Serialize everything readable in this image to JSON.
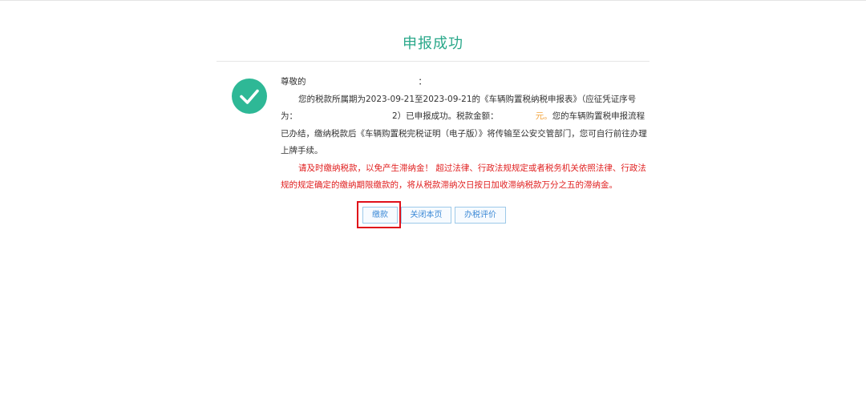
{
  "header": {
    "title": "申报成功"
  },
  "message": {
    "salutation_prefix": "尊敬的",
    "salutation_suffix": "：",
    "line1": "您的税款所属期为2023-09-21至2023-09-21的《车辆购置税纳税申报表》（应征凭证序号为：",
    "seq_tail": "2",
    "line1_after_seq": "）已申报成功。税款金额：",
    "amount_tail": "元。",
    "line2": "您的车辆购置税申报流程已办结，缴纳税款后《车辆购置税完税证明（电子版）》将传输至公安交管部门，您可自行前往办理上牌手续。",
    "warning": "请及时缴纳税款，以免产生滞纳金！ 超过法律、行政法规规定或者税务机关依照法律、行政法规的规定确定的缴纳期限缴款的，将从税款滞纳次日按日加收滞纳税款万分之五的滞纳金。"
  },
  "buttons": {
    "pay": "缴款",
    "close": "关闭本页",
    "evaluate": "办税评价"
  },
  "icons": {
    "success": "check-circle-icon"
  },
  "colors": {
    "accent": "#2aa88a",
    "success_badge": "#2eb896",
    "warning_text": "#e02020",
    "button_border": "#9dc9e9",
    "button_text": "#3d8ad6",
    "highlight": "#e0101a"
  }
}
